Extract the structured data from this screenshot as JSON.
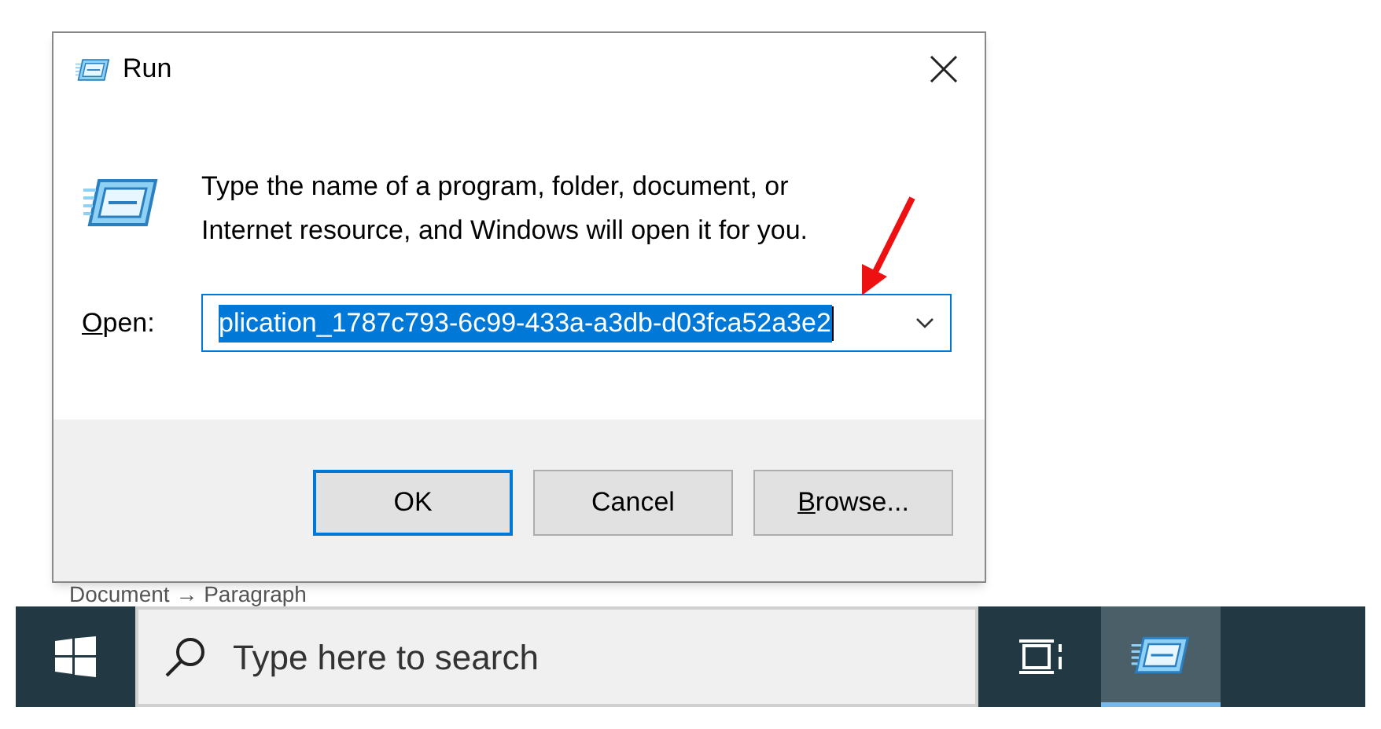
{
  "background": {
    "breadcrumb": "Document → Paragraph"
  },
  "dialog": {
    "title": "Run",
    "message": "Type the name of a program, folder, document, or Internet resource, and Windows will open it for you.",
    "open_label": {
      "access_key": "O",
      "rest": "pen:"
    },
    "open_field": {
      "value": "plication_1787c793-6c99-433a-a3db-d03fca52a3e2",
      "selected": true
    },
    "buttons": [
      {
        "rest": "OK",
        "default": true
      },
      {
        "rest": "Cancel",
        "default": false
      },
      {
        "access_key": "B",
        "rest": "rowse...",
        "default": false
      }
    ]
  },
  "taskbar": {
    "search": {
      "placeholder": "Type here to search"
    },
    "apps": [
      {
        "kind": "task-view",
        "active": false
      },
      {
        "kind": "run",
        "active": true
      }
    ]
  }
}
